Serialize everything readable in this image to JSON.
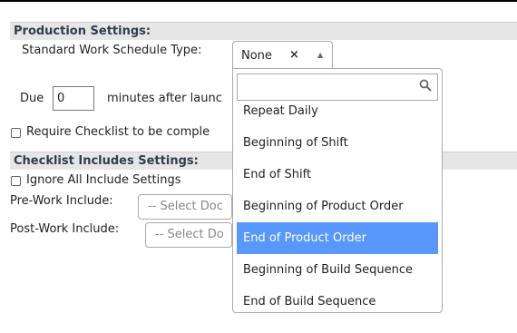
{
  "production": {
    "header": "Production Settings:",
    "schedule_label": "Standard Work Schedule Type:",
    "schedule_value": "None",
    "clear_glyph": "×",
    "arrow_glyph": "▲",
    "due_label": "Due",
    "due_value": "0",
    "due_suffix": "minutes after launc",
    "checklist_label": "Require Checklist to be comple"
  },
  "dropdown": {
    "search_value": "",
    "selected_index": 4,
    "options": [
      "Repeat Daily",
      "Beginning of Shift",
      "End of Shift",
      "Beginning of Product Order",
      "End of Product Order",
      "Beginning of Build Sequence",
      "End of Build Sequence"
    ]
  },
  "include_settings": {
    "header": "Checklist Includes Settings:",
    "ignore_label": "Ignore All Include Settings",
    "prework_label": "Pre-Work Include:",
    "prework_placeholder": "-- Select Doc",
    "postwork_label": "Post-Work Include:",
    "postwork_placeholder": "-- Select Do"
  },
  "icons": {
    "search": "search-icon"
  },
  "colors": {
    "selected_option": "#5897fb",
    "section_header_bg": "#e6e6e6",
    "section_header_text": "#2f3e4d"
  }
}
